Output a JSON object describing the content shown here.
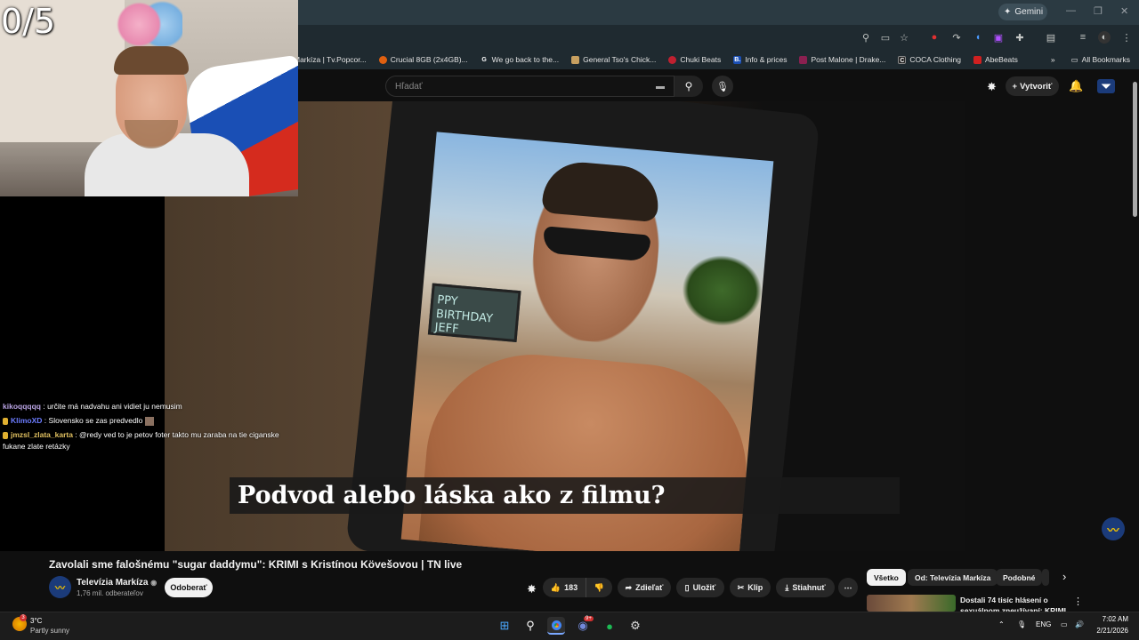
{
  "browser": {
    "gemini_label": "Gemini",
    "bookmarks": [
      {
        "label": "Markíza | Tv.Popcor...",
        "color": "#3a6ea5",
        "icon": ""
      },
      {
        "label": "Crucial 8GB (2x4GB)...",
        "color": "#e06010",
        "icon": ""
      },
      {
        "label": "We go back to the...",
        "color": "#444",
        "icon": "G"
      },
      {
        "label": "General Tso's Chick...",
        "color": "#c8a060",
        "icon": ""
      },
      {
        "label": "Chuki Beats",
        "color": "#c02030",
        "icon": ""
      },
      {
        "label": "Info & prices",
        "color": "#1a4fb5",
        "icon": "B."
      },
      {
        "label": "Post Malone | Drake...",
        "color": "#8a2050",
        "icon": ""
      },
      {
        "label": "COCA Clothing",
        "color": "#222",
        "icon": "C"
      },
      {
        "label": "AbeBeats",
        "color": "#d02020",
        "icon": ""
      }
    ],
    "all_bookmarks": "All Bookmarks",
    "more_bookmarks": "»"
  },
  "youtube": {
    "search_placeholder": "Hľadať",
    "create_label": "Vytvoriť"
  },
  "stream": {
    "counter": "0/5",
    "chat": [
      {
        "user": "kikoqqqqq",
        "message": ": určite má nadvahu ani vidiet ju nemusim",
        "badge": false
      },
      {
        "user": "KlimoXD",
        "message": ": Slovensko se zas predvedlo",
        "badge": true
      },
      {
        "user": "jmzsl_zlata_karta",
        "message": ": @redy ved to je petov foter takto mu zaraba na tie ciganske fukane zlate retázky",
        "badge": true
      }
    ]
  },
  "video": {
    "caption": "Podvod alebo láska ako z filmu?",
    "photo_sign": "PPY BIRTHDAY JEFF",
    "title": "Zavolali sme falošnému \"sugar daddymu\": KRIMI s Kristínou Kövešovou | TN live",
    "channel_name": "Televízia Markíza",
    "channel_verified": "◉",
    "subscribers": "1,76 mil. odberateľov",
    "subscribe_label": "Odoberať",
    "likes": "183",
    "share_label": "Zdieľať",
    "save_label": "Uložiť",
    "clip_label": "Klip",
    "download_label": "Stiahnuť"
  },
  "recommendations": {
    "chips": [
      "Všetko",
      "Od: Televízia Markíza",
      "Podobné"
    ],
    "first_title": "Dostali 74 tisíc hlásení o sexuálnom zneužívaní: KRIMI"
  },
  "taskbar": {
    "weather_temp": "3°C",
    "weather_desc": "Partly sunny",
    "weather_badge": "3",
    "language": "ENG",
    "time": "7:02 AM",
    "date": "2/21/2026",
    "discord_badge": "9+"
  }
}
